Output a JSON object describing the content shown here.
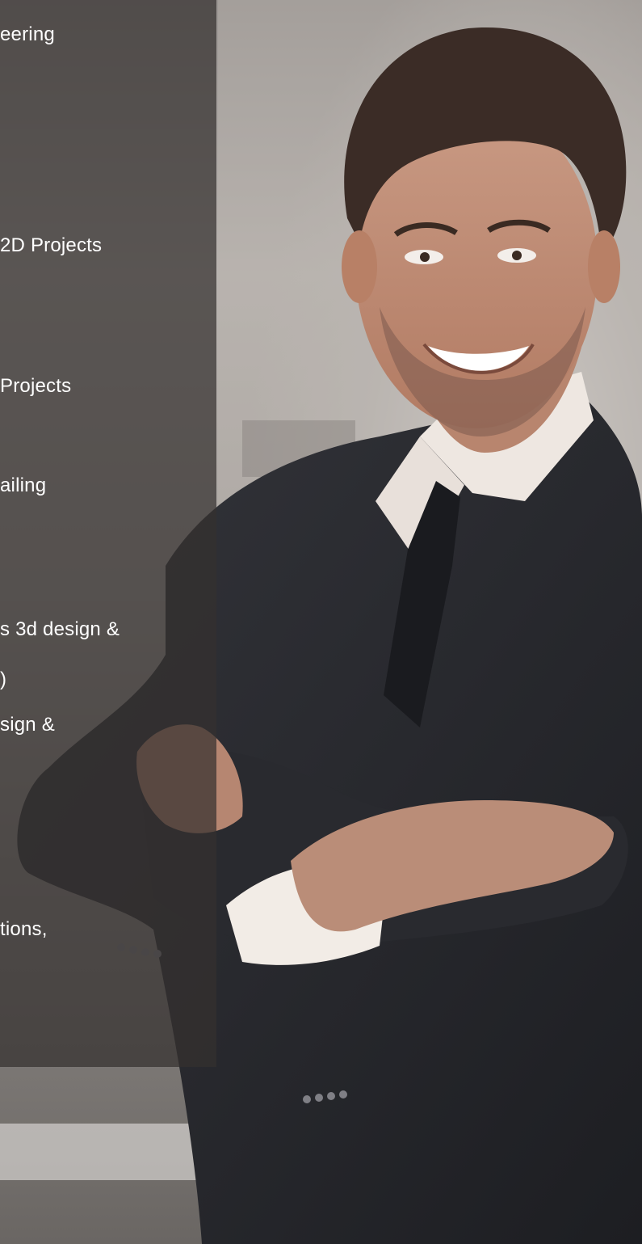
{
  "panel": {
    "lines": [
      "eering",
      "2D Projects",
      " Projects",
      "ailing",
      "s 3d design &",
      ")",
      "sign &",
      "tions,"
    ]
  },
  "colors": {
    "panel_overlay": "#34312f",
    "text": "#ffffff",
    "suit": "#26272c",
    "shirt": "#efe8e2",
    "skin": "#c38f76"
  }
}
